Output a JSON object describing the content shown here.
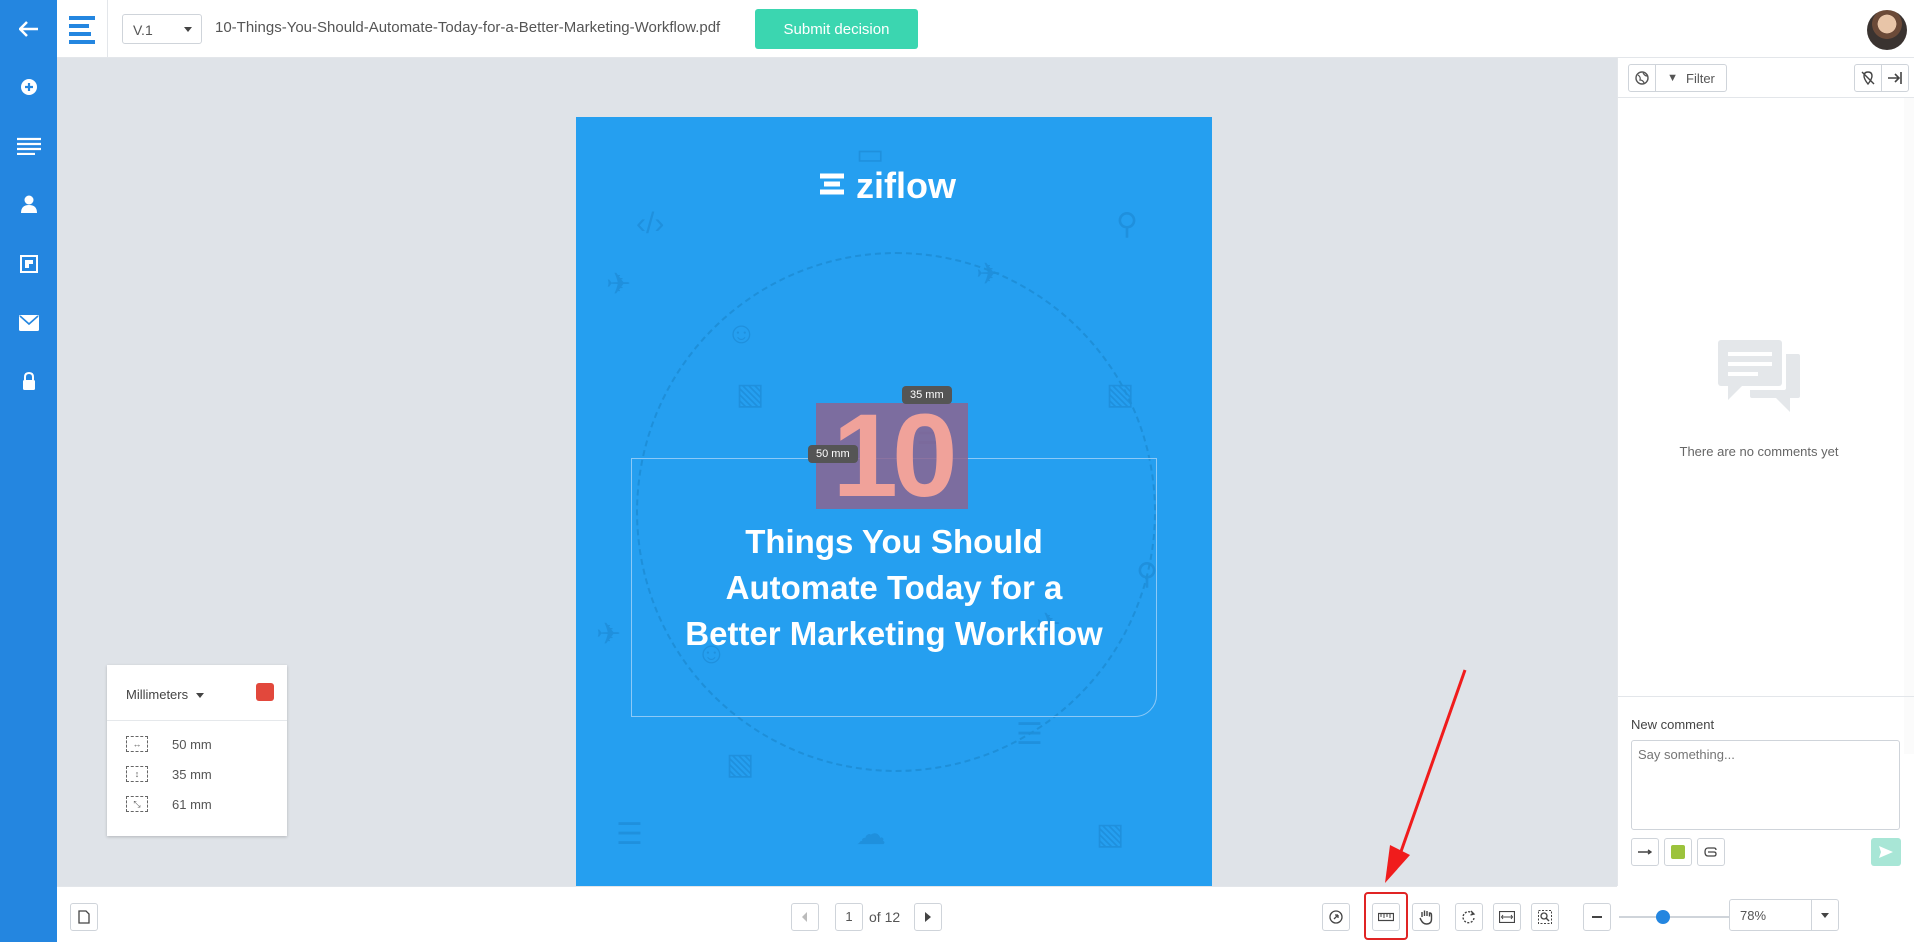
{
  "rail": {
    "items": [
      {
        "name": "back-arrow-icon",
        "glyph": "←"
      },
      {
        "name": "add-icon",
        "glyph": "⊕"
      },
      {
        "name": "list-icon",
        "glyph": "≡"
      },
      {
        "name": "user-icon",
        "glyph": "●"
      },
      {
        "name": "compare-icon",
        "glyph": "◪"
      },
      {
        "name": "mail-icon",
        "glyph": "✉"
      },
      {
        "name": "lock-icon",
        "glyph": "🔒"
      }
    ]
  },
  "topbar": {
    "version": "V.1",
    "filename": "10-Things-You-Should-Automate-Today-for-a-Better-Marketing-Workflow.pdf",
    "submit_label": "Submit decision"
  },
  "page": {
    "brand": "ziflow",
    "number": "10",
    "headline_lines": [
      "Things You Should",
      "Automate Today for a",
      "Better Marketing Workflow"
    ],
    "measure_width_tag": "50 mm",
    "measure_height_tag": "35 mm"
  },
  "measurement_panel": {
    "unit": "Millimeters",
    "color": "#e2483c",
    "rows": [
      {
        "icon": "width-measure-icon",
        "value": "50 mm"
      },
      {
        "icon": "height-measure-icon",
        "value": "35 mm"
      },
      {
        "icon": "diagonal-measure-icon",
        "value": "61 mm"
      }
    ]
  },
  "comments": {
    "filter_label": "Filter",
    "empty_text": "There are no comments yet",
    "new_comment_label": "New comment",
    "placeholder": "Say something..."
  },
  "bottombar": {
    "page_current": "1",
    "page_total_label": "of 12",
    "zoom_value": "78%",
    "zoom_level": 0.33
  },
  "colors": {
    "rail": "#2486e0",
    "accent": "#3bd6b0",
    "page_blue": "#259ff0",
    "highlight_red": "#e02424"
  }
}
